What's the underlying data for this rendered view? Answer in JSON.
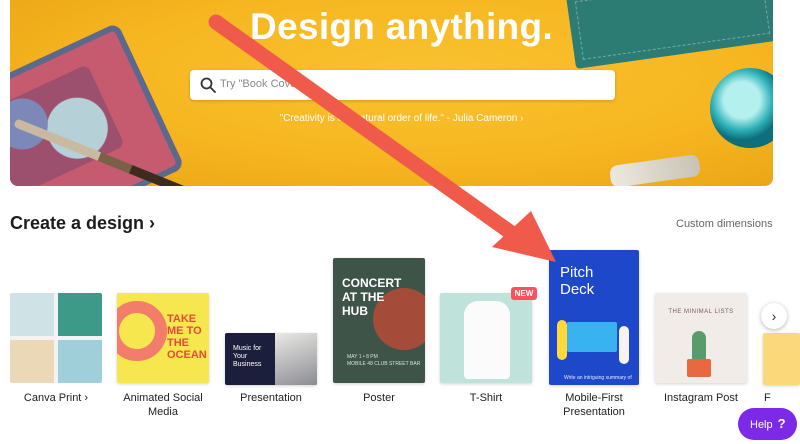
{
  "hero": {
    "title": "Design anything.",
    "search_placeholder": "Try \"Book Cover",
    "quote": "\"Creativity is the natural order of life.\" - Julia Cameron ›"
  },
  "section": {
    "title": "Create a design ›",
    "custom_dimensions": "Custom dimensions"
  },
  "templates": [
    {
      "label": "Canva Print ›"
    },
    {
      "label": "Animated Social\nMedia",
      "thumb_text": "TAKE\nME TO\nTHE\nOCEAN"
    },
    {
      "label": "Presentation",
      "thumb_text": "Music for\nYour\nBusiness"
    },
    {
      "label": "Poster",
      "thumb_text": "CONCERT\nAT THE\nHUB",
      "thumb_small": "MAY 1 • 8 PM\nMOBILE 48 CLUB STREET BAR"
    },
    {
      "label": "T-Shirt",
      "badge": "NEW"
    },
    {
      "label": "Mobile-First\nPresentation",
      "thumb_text": "Pitch\nDeck",
      "thumb_small": "Write an intriguing summary of"
    },
    {
      "label": "Instagram Post",
      "thumb_text": "THE MINIMAL LISTS"
    },
    {
      "label": "F"
    }
  ],
  "help": {
    "label": "Help",
    "icon": "?"
  },
  "colors": {
    "hero_yellow": "#f6b620",
    "arrow": "#f05a4a",
    "help_purple": "#7d2ae8",
    "pitch_blue": "#1c48c9",
    "new_badge": "#ff4f5e"
  }
}
